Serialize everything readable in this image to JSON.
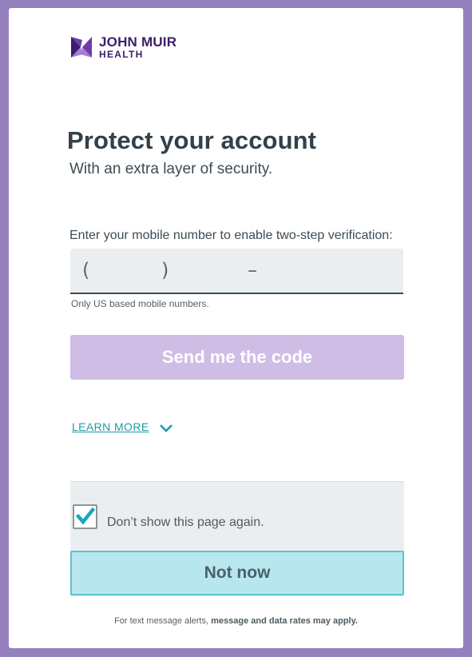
{
  "brand": {
    "line1": "JOHN MUIR",
    "line2": "HEALTH",
    "colors": {
      "purple_dark": "#3a1e6b",
      "purple_mid": "#6e3ea8",
      "purple_light": "#a77bd8"
    }
  },
  "heading": {
    "title": "Protect your account",
    "subtitle": "With an extra layer of security."
  },
  "phone": {
    "label": "Enter your mobile number to enable two-step verification:",
    "open_paren": "(",
    "close_paren": ")",
    "dash": "–",
    "helper": "Only US based mobile numbers."
  },
  "send_button": {
    "label": "Send me the code",
    "color": "#cfbde6"
  },
  "learn_more": {
    "label": "LEARN MORE",
    "icon": "chevron-down-icon",
    "color": "#1d9ca8"
  },
  "dont_show": {
    "label": "Don’t show this page again.",
    "checked": true,
    "check_color": "#1aa6bf"
  },
  "not_now_button": {
    "label": "Not now",
    "color": "#b8e6ee"
  },
  "footer": {
    "prefix": "For text message alerts, ",
    "bold": "message and data rates may apply."
  },
  "page_background": "#9480bd"
}
